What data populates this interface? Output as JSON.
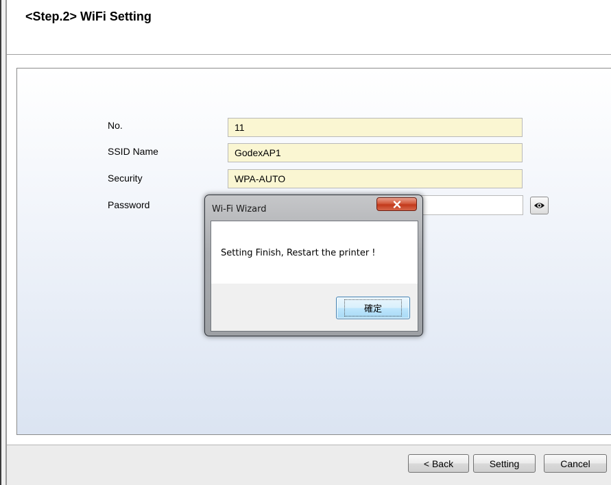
{
  "header": {
    "title": "<Step.2> WiFi Setting"
  },
  "form": {
    "no_label": "No.",
    "no_value": "11",
    "ssid_label": "SSID Name",
    "ssid_value": "GodexAP1",
    "security_label": "Security",
    "security_value": "WPA-AUTO",
    "password_label": "Password",
    "password_value": ""
  },
  "footer": {
    "back_label": "< Back",
    "setting_label": "Setting",
    "cancel_label": "Cancel"
  },
  "dialog": {
    "title": "Wi-Fi Wizard",
    "message": "Setting Finish, Restart the printer !",
    "ok_label": "確定",
    "close_icon": "close-icon"
  },
  "icons": {
    "password_toggle": "eye-icon"
  },
  "colors": {
    "input_bg": "#faf6d2",
    "panel_gradient_end": "#dbe4f2",
    "close_button": "#c2381b"
  }
}
